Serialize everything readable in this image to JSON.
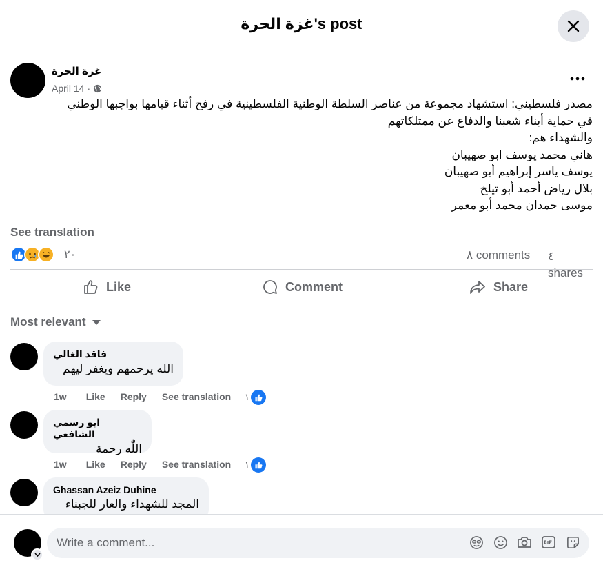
{
  "header": {
    "title": "غزة الحرة's post"
  },
  "post": {
    "author": "غزة الحرة",
    "date": "April 14",
    "separator": "·",
    "lines": [
      "مصدر فلسطيني: استشهاد مجموعة من عناصر السلطة الوطنية الفلسطينية في رفح أثناء قيامها بواجبها الوطني",
      "في حماية أبناء شعبنا والدفاع عن ممتلكاتهم",
      "والشهداء هم:",
      "هاني محمد يوسف ابو صهيبان",
      "يوسف ياسر إبراهيم أبو صهيبان",
      "بلال رياض أحمد أبو تيلخ",
      "موسى حمدان محمد أبو معمر"
    ],
    "see_translation": "See translation",
    "reaction_count": "٢٠",
    "comments": "٨ comments",
    "shares": "٤ shares",
    "reactions": [
      "like",
      "sad",
      "haha"
    ]
  },
  "actions": {
    "like": "Like",
    "comment": "Comment",
    "share": "Share"
  },
  "sort_label": "Most relevant",
  "comments": [
    {
      "author": "فاقد الغالي",
      "text": "الله يرحمهم ويغفر ليهم",
      "time": "1w",
      "like": "Like",
      "reply": "Reply",
      "translate": "See translation",
      "likes": "١"
    },
    {
      "author": "ابو رسمي الشافعي",
      "text": "اللّٰه رحمة",
      "time": "1w",
      "like": "Like",
      "reply": "Reply",
      "translate": "See translation",
      "likes": "١"
    },
    {
      "author": "Ghassan Azeiz Duhine",
      "text": "المجد للشهداء والعار للجبناء"
    }
  ],
  "composer": {
    "placeholder": "Write a comment..."
  },
  "colors": {
    "accent": "#1877f2",
    "secondary_text": "#65676b",
    "bubble": "#f0f2f5",
    "divider": "#ced0d4"
  }
}
